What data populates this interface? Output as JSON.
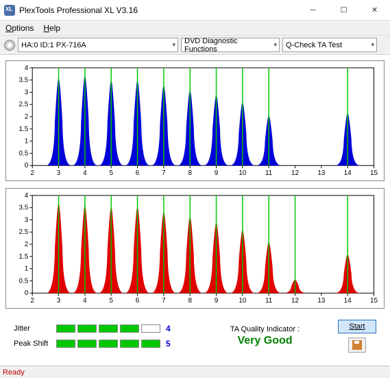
{
  "window": {
    "title": "PlexTools Professional XL V3.16"
  },
  "menu": {
    "options": "Options",
    "help": "Help"
  },
  "toolbar": {
    "device": "HA:0 ID:1   PX-716A",
    "func": "DVD Diagnostic Functions",
    "test": "Q-Check TA Test"
  },
  "chart_data": [
    {
      "type": "bar",
      "color": "#0000d8",
      "ylim": [
        0,
        4
      ],
      "xlim": [
        2,
        15
      ],
      "yticks": [
        0,
        0.5,
        1,
        1.5,
        2,
        2.5,
        3,
        3.5,
        4
      ],
      "xticks": [
        2,
        3,
        4,
        5,
        6,
        7,
        8,
        9,
        10,
        11,
        12,
        13,
        14,
        15
      ],
      "peaks": [
        {
          "x": 3,
          "h": 3.6
        },
        {
          "x": 4,
          "h": 3.7
        },
        {
          "x": 5,
          "h": 3.5
        },
        {
          "x": 6,
          "h": 3.5
        },
        {
          "x": 7,
          "h": 3.3
        },
        {
          "x": 8,
          "h": 3.1
        },
        {
          "x": 9,
          "h": 2.9
        },
        {
          "x": 10,
          "h": 2.6
        },
        {
          "x": 11,
          "h": 2.05
        },
        {
          "x": 14,
          "h": 2.15
        }
      ]
    },
    {
      "type": "bar",
      "color": "#e00000",
      "ylim": [
        0,
        4
      ],
      "xlim": [
        2,
        15
      ],
      "yticks": [
        0,
        0.5,
        1,
        1.5,
        2,
        2.5,
        3,
        3.5,
        4
      ],
      "xticks": [
        2,
        3,
        4,
        5,
        6,
        7,
        8,
        9,
        10,
        11,
        12,
        13,
        14,
        15
      ],
      "peaks": [
        {
          "x": 3,
          "h": 3.7
        },
        {
          "x": 4,
          "h": 3.6
        },
        {
          "x": 5,
          "h": 3.55
        },
        {
          "x": 6,
          "h": 3.55
        },
        {
          "x": 7,
          "h": 3.35
        },
        {
          "x": 8,
          "h": 3.15
        },
        {
          "x": 9,
          "h": 2.9
        },
        {
          "x": 10,
          "h": 2.6
        },
        {
          "x": 11,
          "h": 2.1
        },
        {
          "x": 12,
          "h": 0.55
        },
        {
          "x": 14,
          "h": 1.6
        }
      ]
    }
  ],
  "indicators": {
    "jitter_label": "Jitter",
    "jitter_value": "4",
    "jitter_blocks": 4,
    "peak_label": "Peak Shift",
    "peak_value": "5",
    "peak_blocks": 5,
    "quality_label": "TA Quality Indicator :",
    "quality_value": "Very Good"
  },
  "buttons": {
    "start": "Start"
  },
  "status": {
    "text": "Ready"
  }
}
